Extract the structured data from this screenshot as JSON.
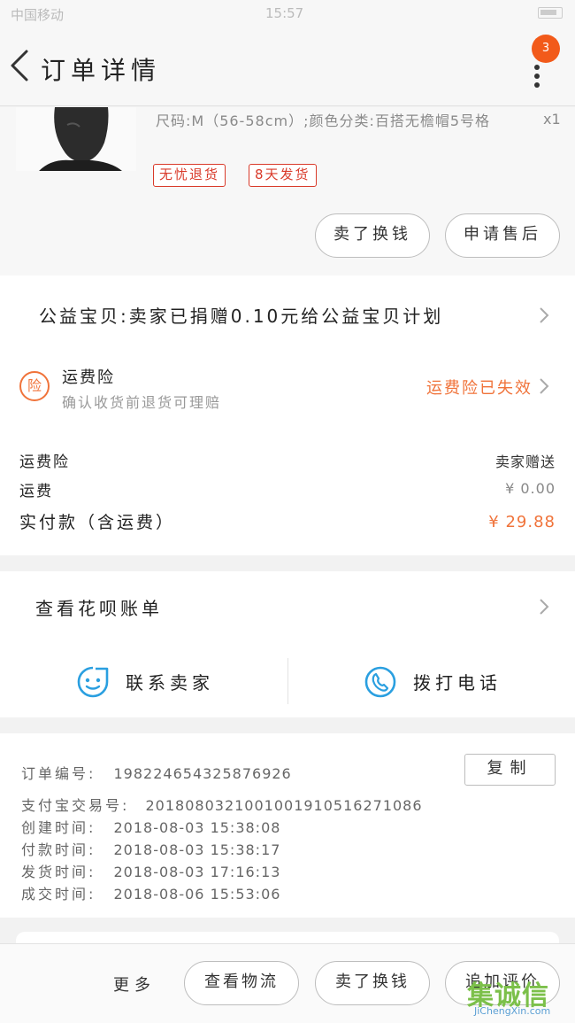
{
  "statusbar": {
    "carrier": "中国移动",
    "time": "15:57"
  },
  "header": {
    "title": "订单详情",
    "badge_count": "3"
  },
  "product": {
    "description": "尺码:M（56-58cm）;颜色分类:百搭无檐帽5号格",
    "quantity": "x1",
    "tags": [
      "无忧退货",
      "8天发货"
    ],
    "buttons": {
      "buy_again": "卖了换钱",
      "after_sale": "申请售后"
    }
  },
  "info": {
    "charity": "公益宝贝:卖家已捐赠0.10元给公益宝贝计划",
    "insurance": {
      "icon_text": "险",
      "title": "运费险",
      "subtitle": "确认收货前退货可理赔",
      "status": "运费险已失效"
    },
    "rows": [
      {
        "label": "运费险",
        "value": "卖家赠送"
      },
      {
        "label": "运费",
        "value": "¥ 0.00"
      },
      {
        "label": "实付款（含运费）",
        "value": "¥ 29.88"
      }
    ]
  },
  "bill": {
    "label": "查看花呗账单"
  },
  "contact": {
    "seller": "联系卖家",
    "phone": "拨打电话"
  },
  "order": {
    "number_label": "订单编号:",
    "number": "198224654325876926",
    "copy_label": "复制",
    "alipay_label": "支付宝交易号:",
    "alipay": "2018080321001001910516271086",
    "created_label": "创建时间:",
    "created": "2018-08-03 15:38:08",
    "paid_label": "付款时间:",
    "paid": "2018-08-03 15:38:17",
    "shipped_label": "发货时间:",
    "shipped": "2018-08-03 17:16:13",
    "completed_label": "成交时间:",
    "completed": "2018-08-06 15:53:06"
  },
  "bottombar": {
    "more": "更多",
    "logistics": "查看物流",
    "sell": "卖了换钱",
    "review": "追加评价"
  },
  "watermark": {
    "logo": "集诚信",
    "url": "JiChengXin.com"
  },
  "colors": {
    "accent": "#f0733a",
    "tag_red": "#d93a2a",
    "contact_blue": "#2a9fe0",
    "badge": "#f25a1a"
  },
  "icons": [
    "back-icon",
    "more-vertical-icon",
    "chevron-right-icon",
    "insurance-icon",
    "chat-face-icon",
    "phone-icon"
  ]
}
